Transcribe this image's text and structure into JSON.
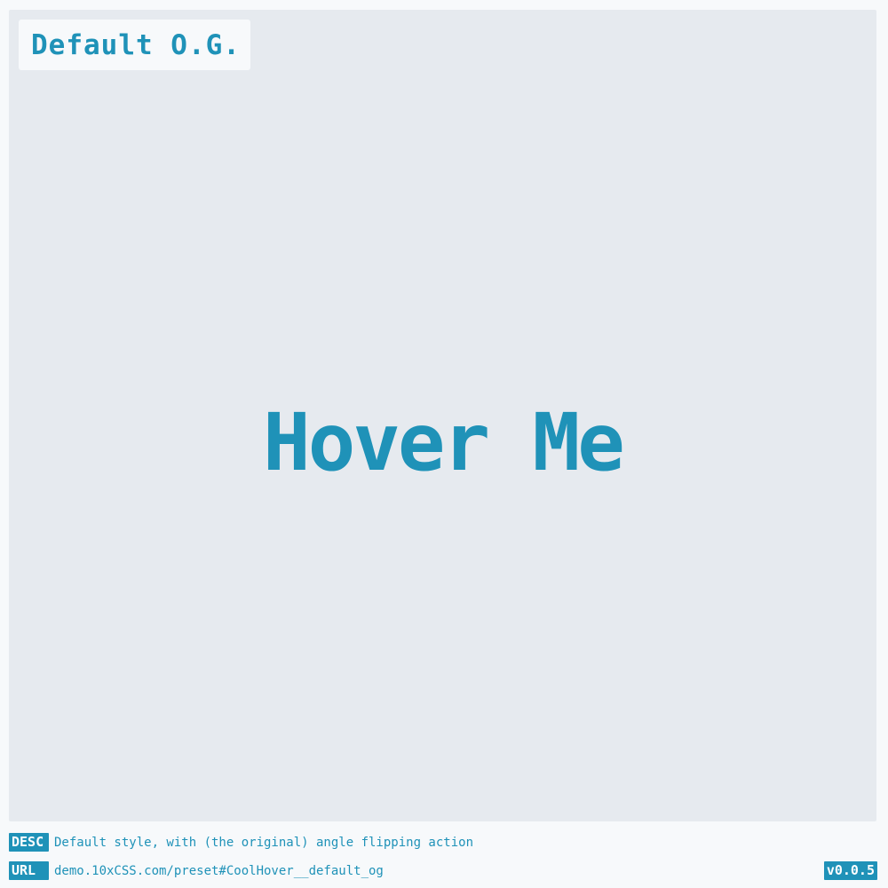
{
  "header": {
    "title": "Default O.G."
  },
  "demo": {
    "button_label": "Hover Me"
  },
  "footer": {
    "desc_tag": "DESC",
    "desc_text": "Default style, with (the original) angle flipping action",
    "url_tag": "URL",
    "url_text": "demo.10xCSS.com/preset#CoolHover__default_og",
    "version": "v0.0.5"
  },
  "colors": {
    "accent": "#1f92b8",
    "stage_background": "#e6eaef",
    "page_background": "#f7f9fb"
  }
}
